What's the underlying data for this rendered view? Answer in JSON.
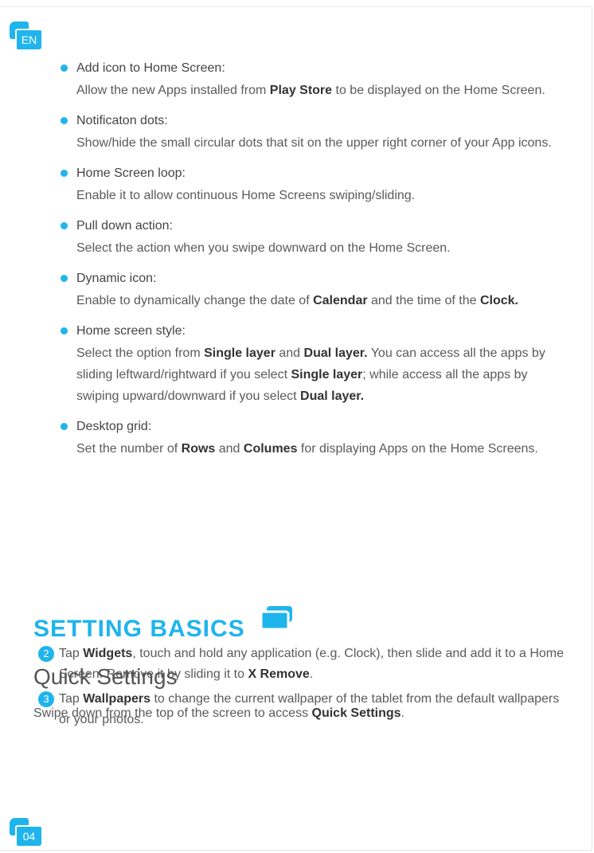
{
  "header": {
    "lang_badge": "EN"
  },
  "options": [
    {
      "title": "Add icon to Home Screen:",
      "desc": [
        {
          "t": "Allow the new Apps installed from "
        },
        {
          "t": "Play Store",
          "b": true
        },
        {
          "t": " to be displayed on the Home Screen."
        }
      ]
    },
    {
      "title": "Notificaton dots:",
      "desc": [
        {
          "t": "Show/hide the small circular dots that sit on the upper right corner of your App icons."
        }
      ]
    },
    {
      "title": "Home Screen loop:",
      "desc": [
        {
          "t": "Enable it to allow continuous Home Screens swiping/sliding."
        }
      ]
    },
    {
      "title": "Pull down action:",
      "desc": [
        {
          "t": "Select the action when you swipe downward on the Home Screen."
        }
      ]
    },
    {
      "title": "Dynamic icon:",
      "desc": [
        {
          "t": "Enable to dynamically change the date of "
        },
        {
          "t": "Calendar",
          "b": true
        },
        {
          "t": " and the time of the "
        },
        {
          "t": "Clock.",
          "b": true
        }
      ]
    },
    {
      "title": "Home screen style:",
      "desc": [
        {
          "t": "Select the option from "
        },
        {
          "t": "Single layer",
          "b": true
        },
        {
          "t": " and "
        },
        {
          "t": "Dual layer.",
          "b": true
        },
        {
          "t": " You can access all the apps by sliding leftward/rightward if you select "
        },
        {
          "t": "Single layer",
          "b": true
        },
        {
          "t": "; while access all the apps by swiping upward/downward if you select "
        },
        {
          "t": "Dual layer.",
          "b": true
        }
      ]
    },
    {
      "title": "Desktop grid:",
      "desc": [
        {
          "t": "Set the number of "
        },
        {
          "t": "Rows",
          "b": true
        },
        {
          "t": " and "
        },
        {
          "t": "Columes",
          "b": true
        },
        {
          "t": " for displaying Apps on the Home Screens."
        }
      ]
    }
  ],
  "steps": [
    {
      "num": "2",
      "text": [
        {
          "t": "Tap "
        },
        {
          "t": "Widgets",
          "b": true
        },
        {
          "t": ", touch and hold any application (e.g. Clock), then slide and add it to a Home Screen. Remove it by sliding it to "
        },
        {
          "t": "X Remove",
          "b": true
        },
        {
          "t": "."
        }
      ]
    },
    {
      "num": "3",
      "text": [
        {
          "t": "Tap "
        },
        {
          "t": "Wallpapers",
          "b": true
        },
        {
          "t": " to change the current wallpaper of the tablet from the default wallpapers or your photos."
        }
      ]
    }
  ],
  "section": {
    "heading": "SETTING BASICS",
    "subheading": "Quick Settings",
    "body": [
      {
        "t": "Swipe down from the top of the screen to access "
      },
      {
        "t": "Quick Settings",
        "b": true
      },
      {
        "t": "."
      }
    ]
  },
  "footer": {
    "page_number": "04"
  },
  "colors": {
    "accent": "#1fb4ec",
    "text": "#4a4a4a"
  }
}
